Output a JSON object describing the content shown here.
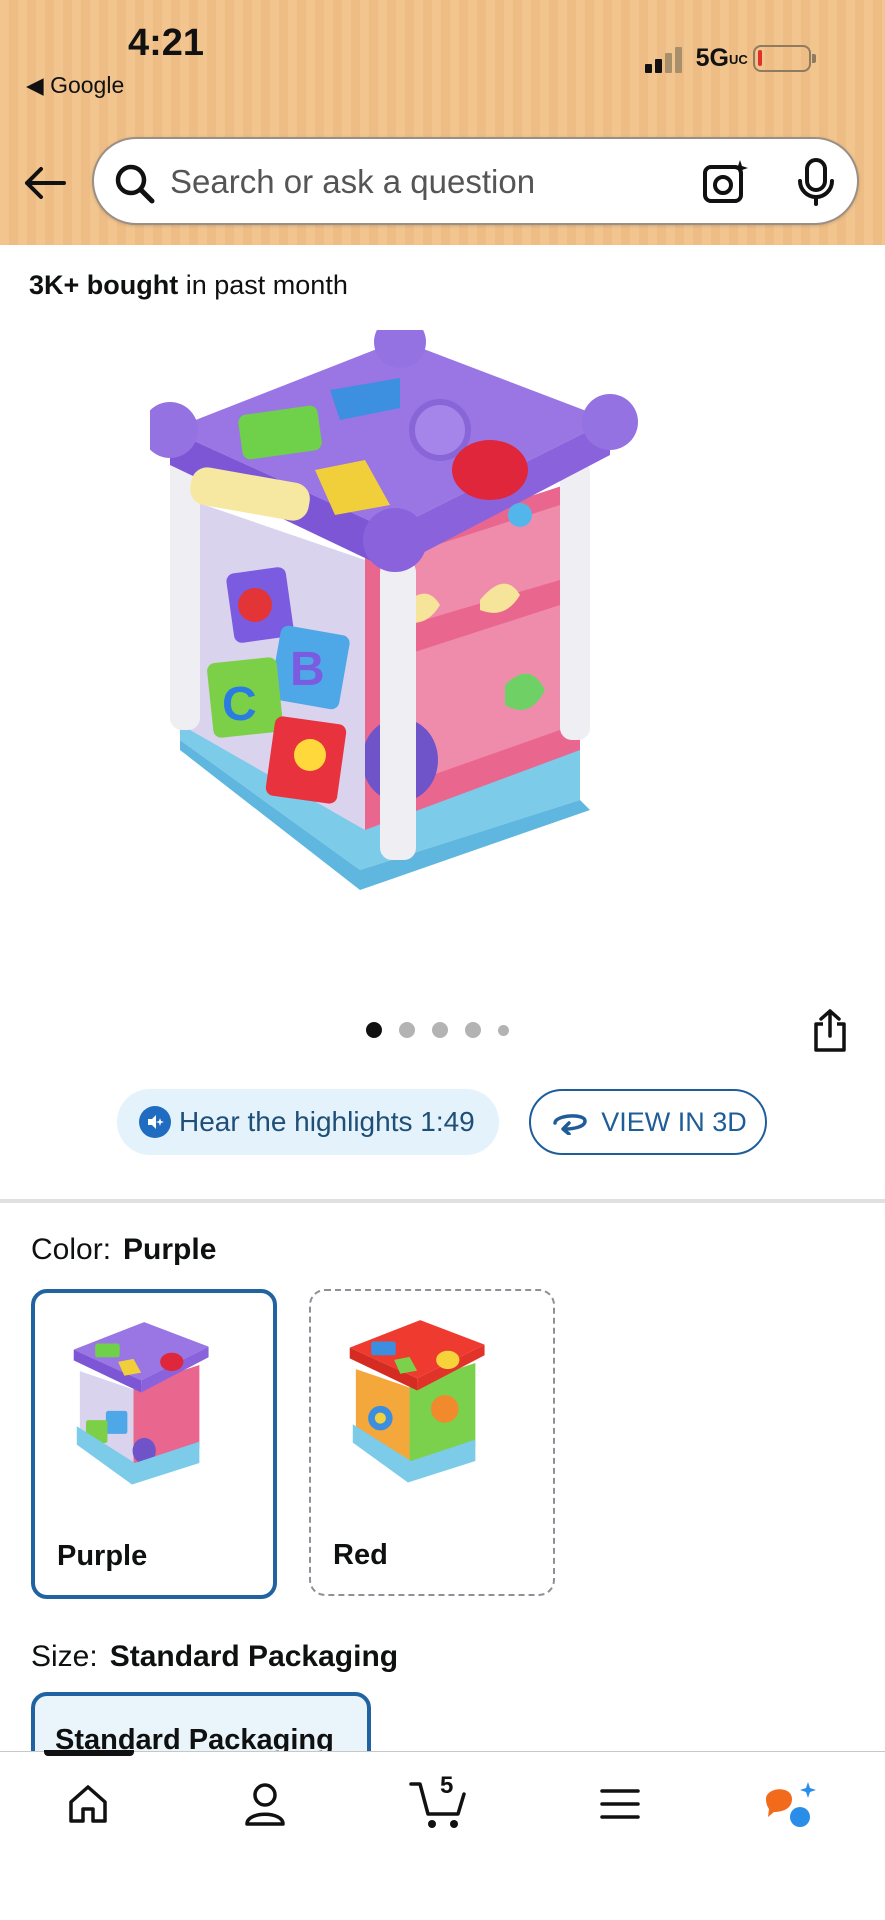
{
  "status_bar": {
    "time": "4:21",
    "back_app": "◀ Google",
    "network": "5G",
    "network_suffix": "UC"
  },
  "search": {
    "placeholder": "Search or ask a question"
  },
  "product": {
    "bought_bold": "3K+ bought",
    "bought_rest": " in past month",
    "image_dots": 5,
    "active_dot": 0,
    "hear_highlights_label": "Hear the highlights 1:49",
    "view_3d_label": "VIEW IN 3D"
  },
  "color": {
    "label": "Color:",
    "selected": "Purple",
    "options": [
      {
        "name": "Purple",
        "selected": true
      },
      {
        "name": "Red",
        "selected": false
      }
    ]
  },
  "size": {
    "label": "Size:",
    "selected": "Standard Packaging",
    "options": [
      {
        "name": "Standard Packaging",
        "selected": true
      }
    ]
  },
  "bottom_nav": {
    "cart_count": "5",
    "items": [
      "home",
      "account",
      "cart",
      "menu",
      "rufus"
    ]
  },
  "colors": {
    "header_bg": "#f2c58f",
    "selected_border": "#2162a1",
    "link_blue": "#1f5d99",
    "hear_bg": "#e4f2fb"
  }
}
